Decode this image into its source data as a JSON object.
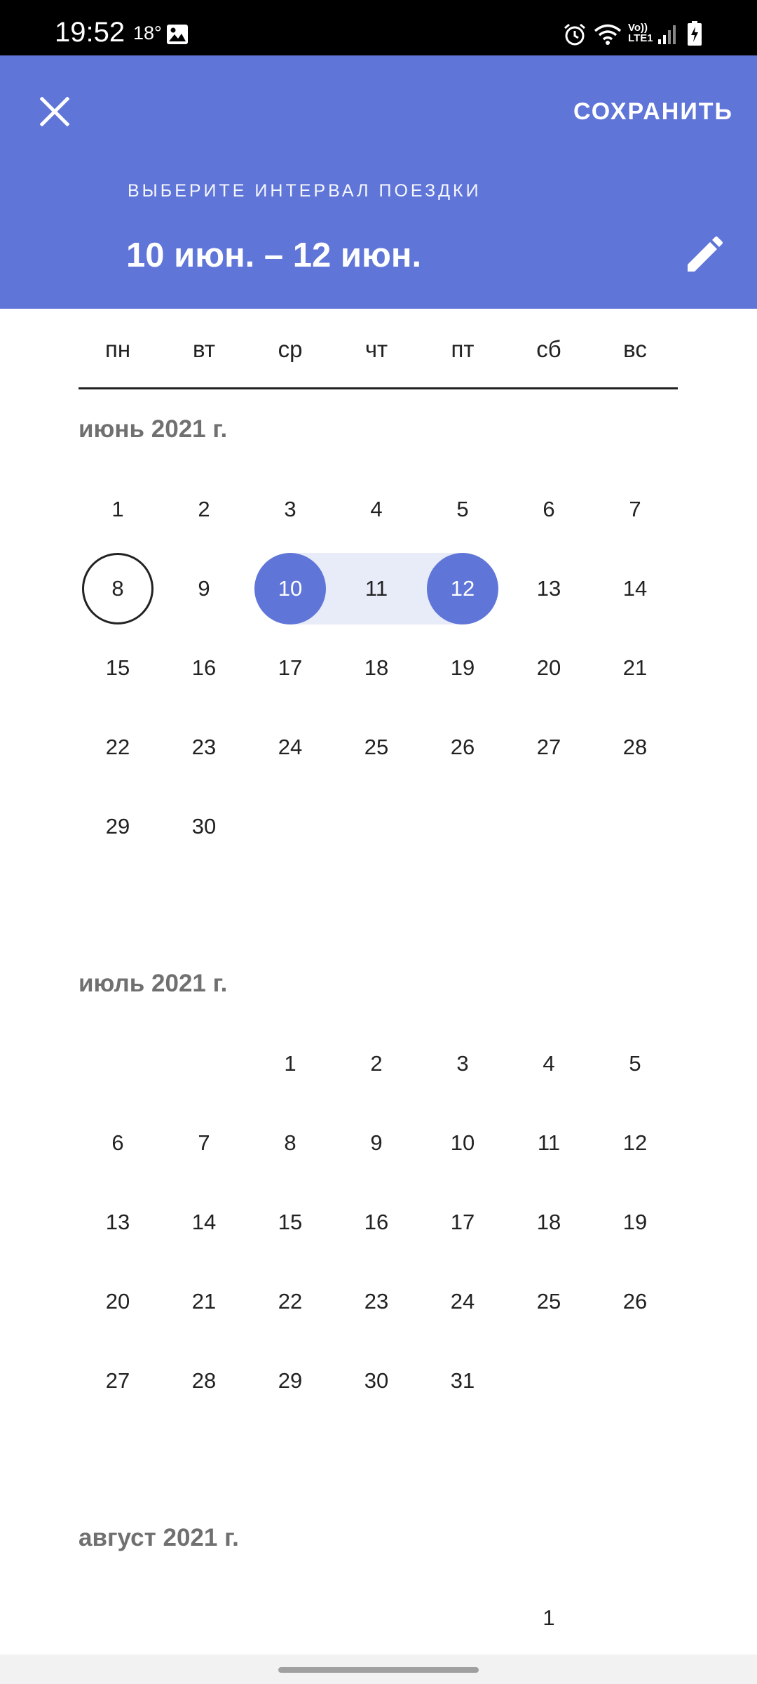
{
  "status_bar": {
    "time": "19:52",
    "temperature": "18°",
    "icons": [
      "gallery-icon",
      "alarm-icon",
      "wifi-icon",
      "volte-icon",
      "signal-icon",
      "battery-charging-icon"
    ],
    "volte_line1": "Vo))",
    "volte_line2": "LTE1"
  },
  "header": {
    "close_icon": "close-icon",
    "save_label": "СОХРАНИТЬ",
    "subtitle": "ВЫБЕРИТЕ ИНТЕРВАЛ ПОЕЗДКИ",
    "range": "10 июн. – 12 июн.",
    "edit_icon": "pencil-icon",
    "background": "#5f75d8"
  },
  "weekdays": [
    "пн",
    "вт",
    "ср",
    "чт",
    "пт",
    "сб",
    "вс"
  ],
  "months": [
    {
      "title": "июнь 2021 г.",
      "first_weekday": 1,
      "days": 30,
      "today": 8,
      "range_start": 10,
      "range_end": 12
    },
    {
      "title": "июль 2021 г.",
      "first_weekday": 3,
      "days": 31
    },
    {
      "title": "август 2021 г.",
      "first_weekday": 6,
      "days": 1
    }
  ],
  "colors": {
    "accent": "#5f75d8",
    "range_fill": "#e8ebf8",
    "text": "#222222",
    "month_title": "#707070"
  }
}
